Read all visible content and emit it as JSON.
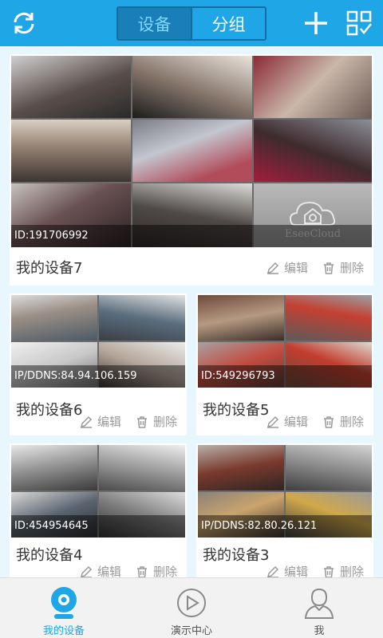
{
  "header": {
    "refresh_icon": "refresh-icon",
    "tabs": [
      {
        "label": "设备",
        "active": true
      },
      {
        "label": "分组",
        "active": false
      }
    ],
    "add_icon": "plus-icon",
    "qr_icon": "qr-scan-icon",
    "accent": "#1fa6e6"
  },
  "actions": {
    "edit": "编辑",
    "delete": "删除"
  },
  "devices": [
    {
      "name": "我的设备7",
      "id": "ID:191706992",
      "watermark": "EseeCloud"
    },
    {
      "name": "我的设备6",
      "id": "IP/DDNS:84.94.106.159"
    },
    {
      "name": "我的设备5",
      "id": "ID:549296793"
    },
    {
      "name": "我的设备4",
      "id": "ID:454954645"
    },
    {
      "name": "我的设备3",
      "id": "IP/DDNS:82.80.26.121"
    }
  ],
  "nav": [
    {
      "label": "我的设备",
      "icon": "camera-icon",
      "active": true
    },
    {
      "label": "演示中心",
      "icon": "play-icon",
      "active": false
    },
    {
      "label": "我",
      "icon": "user-icon",
      "active": false
    }
  ]
}
